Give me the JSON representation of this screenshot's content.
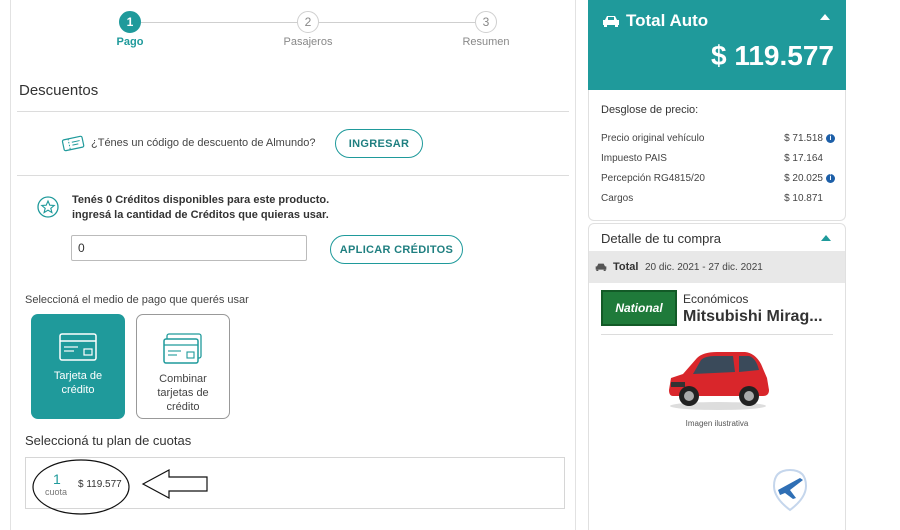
{
  "stepper": {
    "steps": [
      {
        "number": "1",
        "label": "Pago",
        "active": true
      },
      {
        "number": "2",
        "label": "Pasajeros",
        "active": false
      },
      {
        "number": "3",
        "label": "Resumen",
        "active": false
      }
    ]
  },
  "discounts": {
    "title": "Descuentos",
    "coupon_text": "¿Ténes un código de descuento de Almundo?",
    "coupon_button": "INGRESAR",
    "credits_line1": "Tenés 0 Créditos disponibles para este producto.",
    "credits_line2": "ingresá la cantidad de Créditos que quieras usar.",
    "credits_value": "0",
    "apply_button": "APLICAR CRÉDITOS"
  },
  "payment": {
    "label": "Seleccioná el medio de pago que querés usar",
    "options": [
      {
        "label": "Tarjeta de crédito",
        "selected": true
      },
      {
        "label": "Combinar tarjetas de crédito",
        "selected": false
      }
    ]
  },
  "plan": {
    "label": "Seleccioná tu plan de cuotas",
    "quota_count": "1",
    "quota_word": "cuota",
    "amount": "$ 119.577"
  },
  "summary": {
    "title": "Total Auto",
    "total": "$ 119.577",
    "breakdown_title": "Desglose de precio:",
    "rows": [
      {
        "label": "Precio original vehículo",
        "value": "$ 71.518",
        "info": true
      },
      {
        "label": "Impuesto PAIS",
        "value": "$ 17.164",
        "info": false
      },
      {
        "label": "Percepción RG4815/20",
        "value": "$ 20.025",
        "info": true
      },
      {
        "label": "Cargos",
        "value": "$ 10.871",
        "info": false
      }
    ]
  },
  "detail": {
    "title": "Detalle de tu compra",
    "total_label": "Total",
    "dates": "20 dic. 2021 - 27 dic. 2021",
    "brand": "National",
    "category": "Económicos",
    "car_name": "Mitsubishi Mirag...",
    "image_caption": "Imagen ilustrativa"
  },
  "colors": {
    "accent": "#1f9a9b",
    "info": "#1d5fa8",
    "brand_green": "#1f7a3a"
  }
}
